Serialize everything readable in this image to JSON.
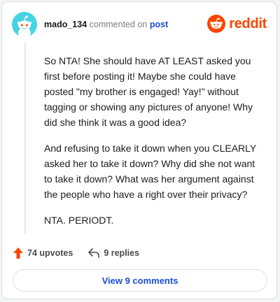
{
  "comment": {
    "username": "mado_134",
    "action_text": "commented on",
    "target_link": "post",
    "paragraphs": [
      "So NTA! She should have AT LEAST asked you first before posting it! Maybe she could have posted \"my brother is engaged! Yay!\" without tagging or showing any pictures of anyone! Why did she think it was a good idea?",
      "And refusing to take it down when you CLEARLY asked her to take it down? Why did she not want to take it down? What was her argument against the people who have a right over their privacy?",
      "NTA. PERIODT."
    ]
  },
  "brand": {
    "name": "reddit",
    "icon": "reddit-snoo-icon",
    "color": "#ff4500"
  },
  "avatar": {
    "icon": "snoo-avatar-icon",
    "color": "#46d3e3"
  },
  "actions": {
    "upvotes_label": "74 upvotes",
    "upvote_icon": "upvote-arrow-icon",
    "upvote_color": "#ff4500",
    "replies_label": "9 replies",
    "reply_icon": "reply-arrow-icon"
  },
  "view_button": {
    "label": "View 9 comments"
  }
}
